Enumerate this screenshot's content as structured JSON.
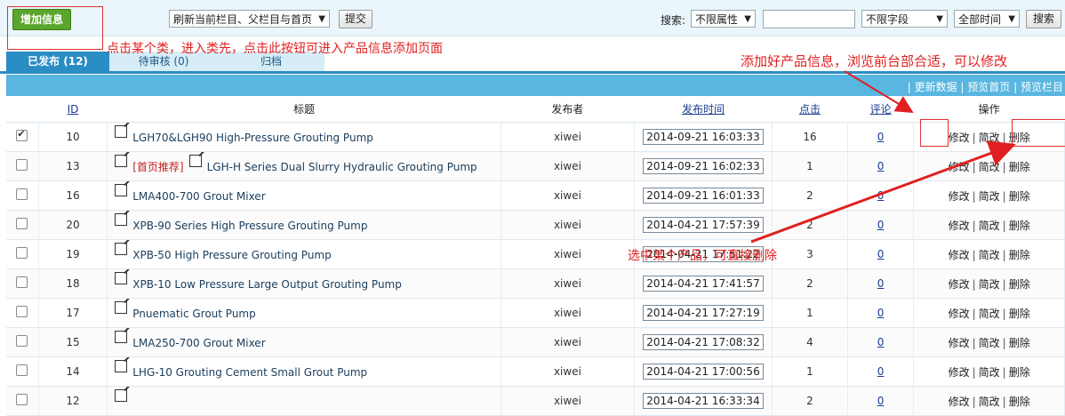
{
  "toolbar": {
    "add_label": "增加信息",
    "refresh_select": "刷新当前栏目、父栏目与首页",
    "submit_label": "提交",
    "search_label": "搜索:",
    "attr_select": "不限属性",
    "search_value": "",
    "field_select": "不限字段",
    "time_select": "全部时间",
    "search_button": "搜索"
  },
  "tabs": [
    {
      "label": "已发布 (12)"
    },
    {
      "label": "待审核 (0)"
    },
    {
      "label": "归档"
    }
  ],
  "top_links": [
    "更新数据",
    "预览首页",
    "预览栏目"
  ],
  "columns": [
    "ID",
    "标题",
    "发布者",
    "发布时间",
    "点击",
    "评论",
    "操作"
  ],
  "ops": {
    "edit": "修改",
    "quick_edit": "简改",
    "delete": "删除"
  },
  "rows": [
    {
      "id": "10",
      "tag": "",
      "title": "LGH70&LGH90 High-Pressure Grouting Pump",
      "author": "xiwei",
      "time": "2014-09-21 16:03:33",
      "clicks": "16",
      "comments": "0",
      "checked": true
    },
    {
      "id": "13",
      "tag": "[首页推荐]",
      "title": "LGH-H Series Dual Slurry Hydraulic Grouting Pump",
      "author": "xiwei",
      "time": "2014-09-21 16:02:33",
      "clicks": "1",
      "comments": "0",
      "checked": false
    },
    {
      "id": "16",
      "tag": "",
      "title": "LMA400-700 Grout Mixer",
      "author": "xiwei",
      "time": "2014-09-21 16:01:33",
      "clicks": "2",
      "comments": "0",
      "checked": false
    },
    {
      "id": "20",
      "tag": "",
      "title": "XPB-90 Series High Pressure Grouting Pump",
      "author": "xiwei",
      "time": "2014-04-21 17:57:39",
      "clicks": "2",
      "comments": "0",
      "checked": false
    },
    {
      "id": "19",
      "tag": "",
      "title": "XPB-50 High Pressure Grouting Pump",
      "author": "xiwei",
      "time": "2014-04-21 17:51:22",
      "clicks": "3",
      "comments": "0",
      "checked": false
    },
    {
      "id": "18",
      "tag": "",
      "title": "XPB-10 Low Pressure Large Output Grouting Pump",
      "author": "xiwei",
      "time": "2014-04-21 17:41:57",
      "clicks": "2",
      "comments": "0",
      "checked": false
    },
    {
      "id": "17",
      "tag": "",
      "title": "Pnuematic Grout Pump",
      "author": "xiwei",
      "time": "2014-04-21 17:27:19",
      "clicks": "1",
      "comments": "0",
      "checked": false
    },
    {
      "id": "15",
      "tag": "",
      "title": "LMA250-700 Grout Mixer",
      "author": "xiwei",
      "time": "2014-04-21 17:08:32",
      "clicks": "4",
      "comments": "0",
      "checked": false
    },
    {
      "id": "14",
      "tag": "",
      "title": "LHG-10 Grouting Cement Small Grout Pump",
      "author": "xiwei",
      "time": "2014-04-21 17:00:56",
      "clicks": "1",
      "comments": "0",
      "checked": false
    },
    {
      "id": "12",
      "tag": "",
      "title": "",
      "author": "xiwei",
      "time": "2014-04-21 16:33:34",
      "clicks": "2",
      "comments": "0",
      "checked": false
    }
  ],
  "annotations": {
    "add_hint": "点击某个类，进入类先，点击此按钮可进入产品信息添加页面",
    "edit_hint": "添加好产品信息，浏览前台部合适，可以修改",
    "delete_hint": "选中某个产品，可直接删除"
  },
  "colors": {
    "accent": "#2a8dc4",
    "header_bar": "#58b6e0",
    "add_button": "#5aa52b",
    "annotation": "#e02020"
  }
}
